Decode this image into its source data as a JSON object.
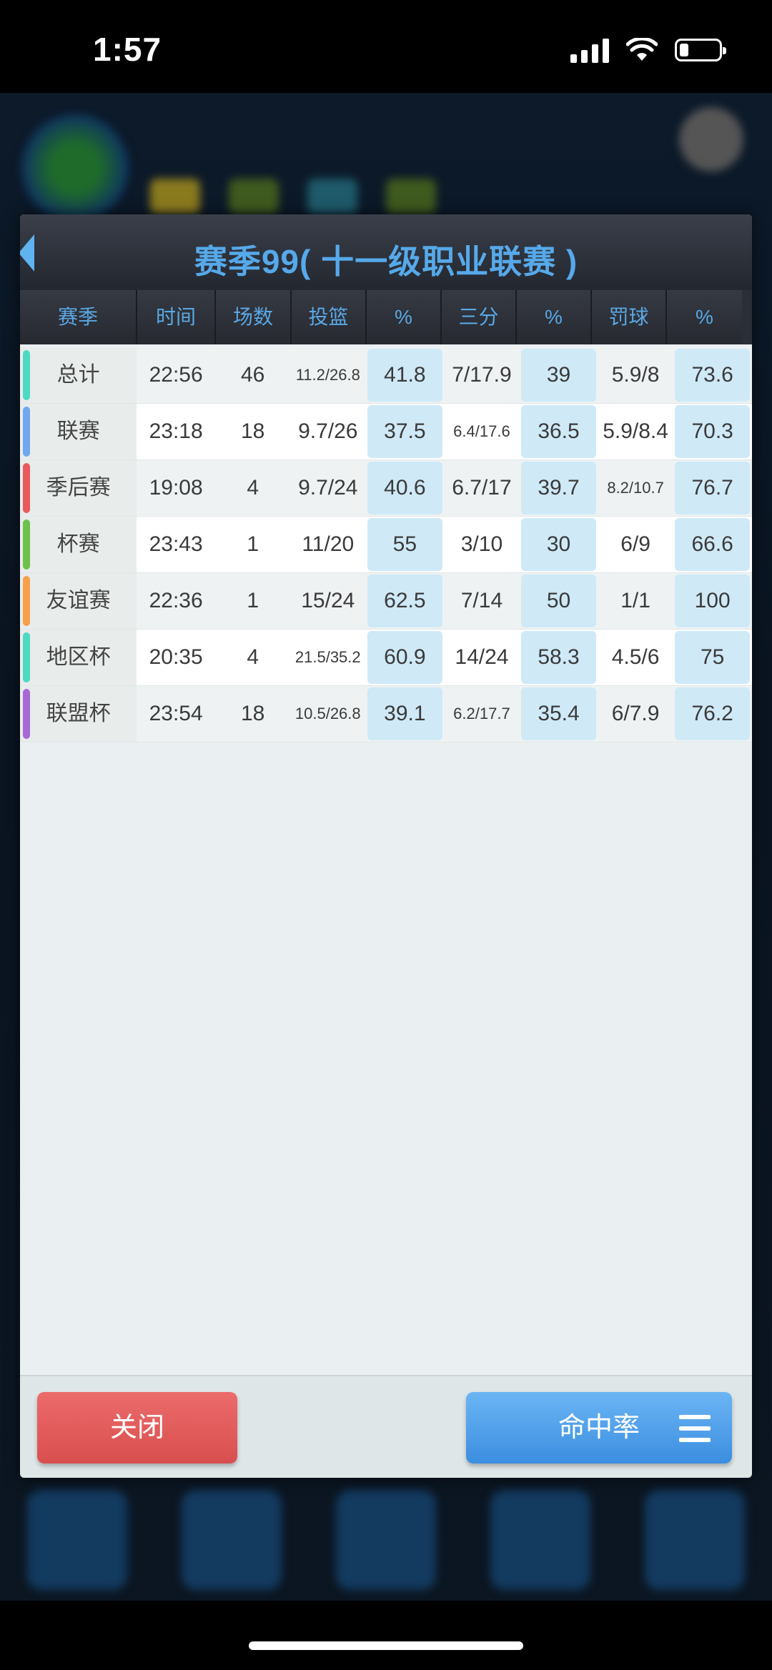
{
  "status_bar": {
    "time": "1:57"
  },
  "dialog": {
    "title": "赛季99( 十一级职业联赛 )",
    "columns": [
      "赛季",
      "时间",
      "场数",
      "投篮",
      "%",
      "三分",
      "%",
      "罚球",
      "%"
    ],
    "rows": [
      {
        "season": "总计",
        "time": "22:56",
        "games": "46",
        "fg": "11.2/26.8",
        "fg_pct": "41.8",
        "three": "7/17.9",
        "three_pct": "39",
        "ft": "5.9/8",
        "ft_pct": "73.6",
        "color": "#4ed9c4"
      },
      {
        "season": "联赛",
        "time": "23:18",
        "games": "18",
        "fg": "9.7/26",
        "fg_pct": "37.5",
        "three": "6.4/17.6",
        "three_pct": "36.5",
        "ft": "5.9/8.4",
        "ft_pct": "70.3",
        "color": "#6fa8f0"
      },
      {
        "season": "季后赛",
        "time": "19:08",
        "games": "4",
        "fg": "9.7/24",
        "fg_pct": "40.6",
        "three": "6.7/17",
        "three_pct": "39.7",
        "ft": "8.2/10.7",
        "ft_pct": "76.7",
        "color": "#e85a5a"
      },
      {
        "season": "杯赛",
        "time": "23:43",
        "games": "1",
        "fg": "11/20",
        "fg_pct": "55",
        "three": "3/10",
        "three_pct": "30",
        "ft": "6/9",
        "ft_pct": "66.6",
        "color": "#6cc24a"
      },
      {
        "season": "友谊赛",
        "time": "22:36",
        "games": "1",
        "fg": "15/24",
        "fg_pct": "62.5",
        "three": "7/14",
        "three_pct": "50",
        "ft": "1/1",
        "ft_pct": "100",
        "color": "#f6a04a"
      },
      {
        "season": "地区杯",
        "time": "20:35",
        "games": "4",
        "fg": "21.5/35.2",
        "fg_pct": "60.9",
        "three": "14/24",
        "three_pct": "58.3",
        "ft": "4.5/6",
        "ft_pct": "75",
        "color": "#4ed9c4"
      },
      {
        "season": "联盟杯",
        "time": "23:54",
        "games": "18",
        "fg": "10.5/26.8",
        "fg_pct": "39.1",
        "three": "6.2/17.7",
        "three_pct": "35.4",
        "ft": "6/7.9",
        "ft_pct": "76.2",
        "color": "#a66ad6"
      }
    ],
    "close_label": "关闭",
    "rate_label": "命中率"
  }
}
